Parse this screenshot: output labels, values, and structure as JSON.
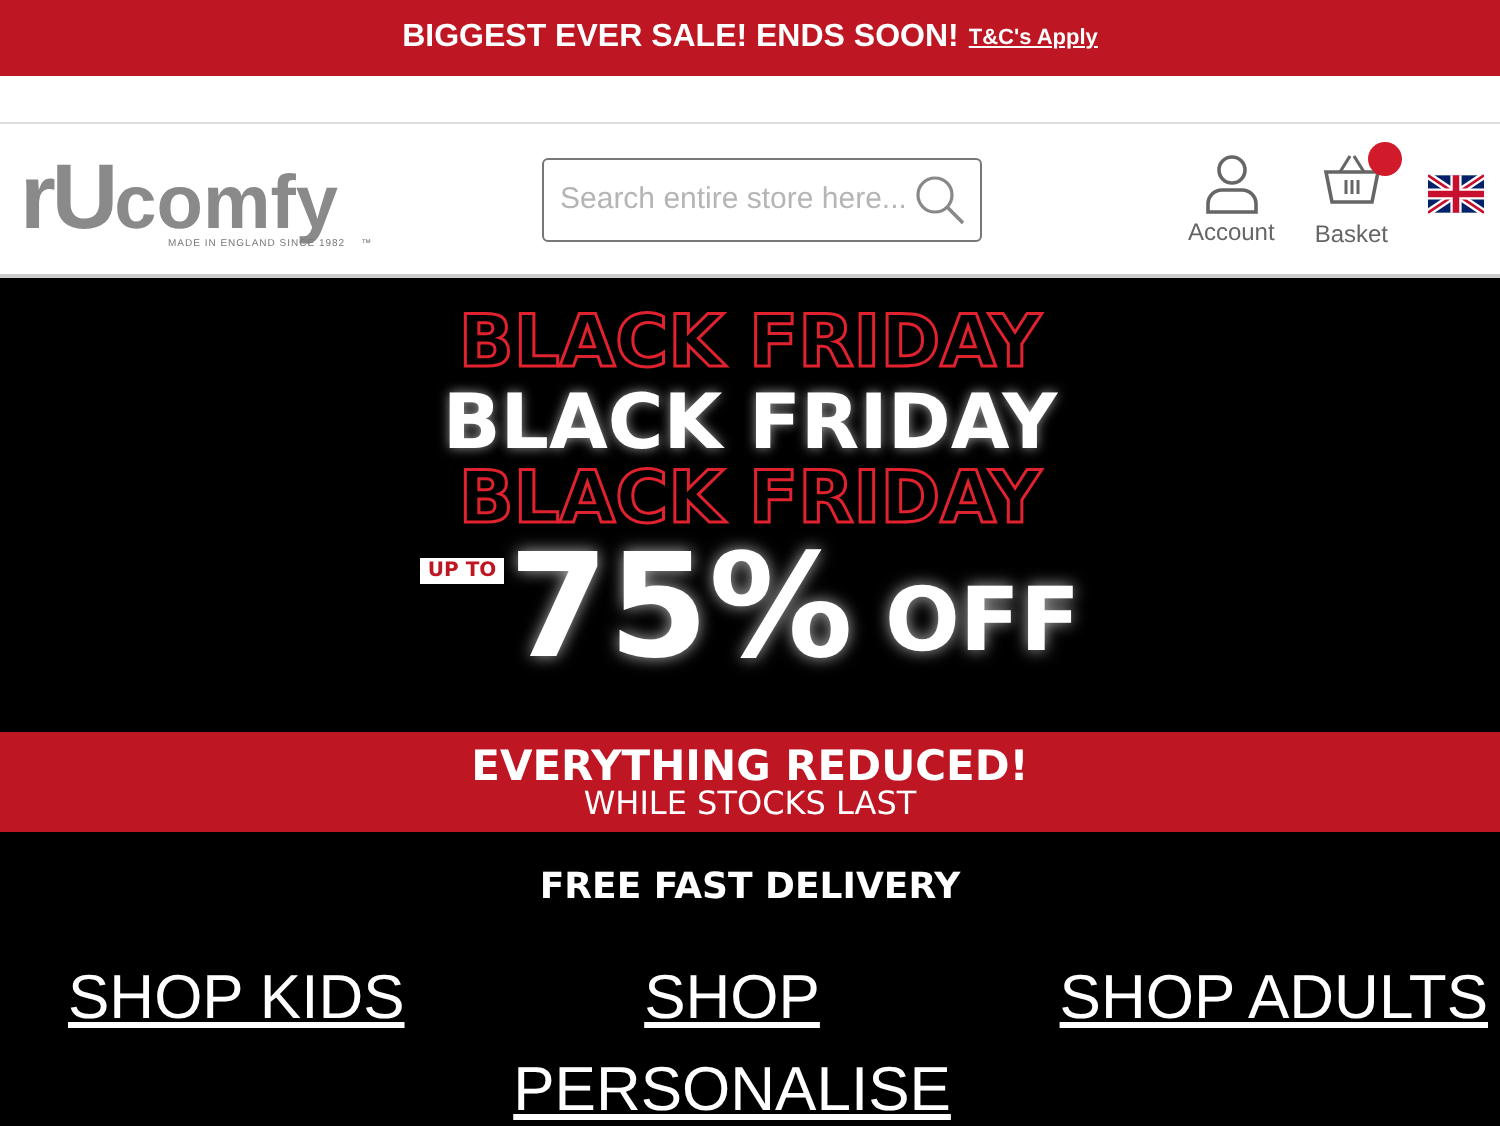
{
  "promo_bar": {
    "text": "BIGGEST EVER SALE! ENDS SOON!",
    "link": "T&C's Apply"
  },
  "header": {
    "logo": {
      "mark": "rU",
      "name": "comfy",
      "tagline": "MADE IN ENGLAND SINCE 1982",
      "tm": "™"
    },
    "search": {
      "placeholder": "Search entire store here..."
    },
    "account": {
      "label": "Account"
    },
    "basket": {
      "label": "Basket",
      "has_items": true
    }
  },
  "hero": {
    "echo_top": "BLACK FRIDAY",
    "title": "BLACK FRIDAY",
    "echo_bottom": "BLACK FRIDAY",
    "up_to": "UP TO",
    "discount": "75%",
    "off": "OFF",
    "band_title": "EVERYTHING REDUCED!",
    "band_subtitle": "WHILE STOCKS LAST"
  },
  "delivery": "FREE FAST DELIVERY",
  "shop_links": [
    "SHOP KIDS",
    "SHOP PERSONALISE",
    "SHOP ADULTS"
  ]
}
